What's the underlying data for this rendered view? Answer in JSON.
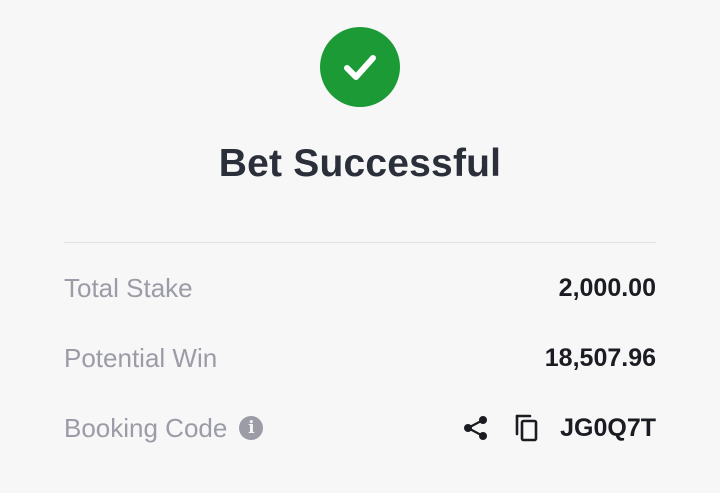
{
  "header": {
    "status_icon": "check-circle-icon",
    "title": "Bet Successful",
    "accent_color": "#1b9a36"
  },
  "details": {
    "total_stake": {
      "label": "Total Stake",
      "value": "2,000.00"
    },
    "potential_win": {
      "label": "Potential Win",
      "value": "18,507.96"
    },
    "booking_code": {
      "label": "Booking Code",
      "info_icon": "info-icon",
      "share_icon": "share-icon",
      "copy_icon": "copy-icon",
      "value": "JG0Q7T"
    }
  }
}
